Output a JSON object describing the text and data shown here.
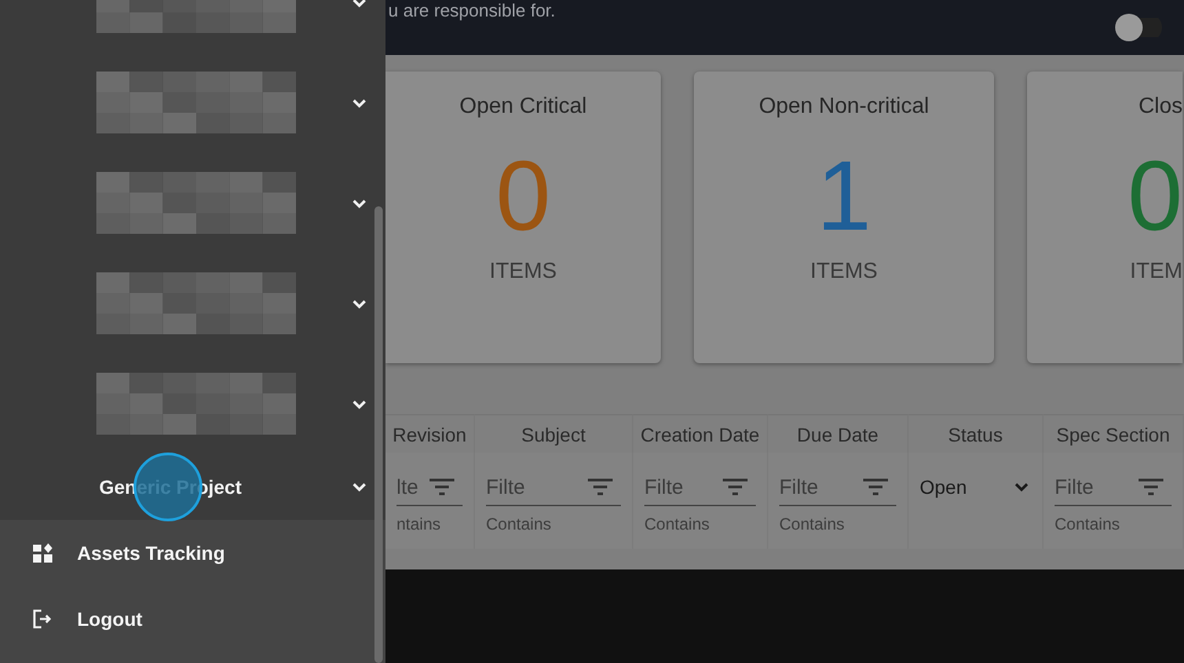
{
  "header": {
    "text": "u are responsible for.",
    "toggle": {
      "on": false
    }
  },
  "drawer": {
    "items": [
      {
        "kind": "redacted",
        "expanded": false
      },
      {
        "kind": "redacted",
        "expanded": false
      },
      {
        "kind": "redacted",
        "expanded": false
      },
      {
        "kind": "redacted",
        "expanded": false
      },
      {
        "kind": "redacted",
        "expanded": false
      },
      {
        "kind": "project",
        "label": "Generic Project",
        "expanded": false
      }
    ],
    "links": [
      {
        "label": "Assets Tracking"
      },
      {
        "label": "Logout"
      }
    ]
  },
  "cards": [
    {
      "title": "Open Critical",
      "value": "0",
      "unit": "ITEMS",
      "color": "#9c5512"
    },
    {
      "title": "Open Non-critical",
      "value": "1",
      "unit": "ITEMS",
      "color": "#1f5f98"
    },
    {
      "title": "Clos",
      "value": "0",
      "unit": "ITEM",
      "color": "#1d6e34"
    }
  ],
  "table": {
    "columns": [
      {
        "label": "Revision",
        "filter": {
          "kind": "text",
          "placeholder": "lte",
          "hint": "ntains"
        }
      },
      {
        "label": "Subject",
        "filter": {
          "kind": "text",
          "placeholder": "Filte",
          "hint": "Contains"
        }
      },
      {
        "label": "Creation Date",
        "filter": {
          "kind": "text",
          "placeholder": "Filte",
          "hint": "Contains"
        }
      },
      {
        "label": "Due Date",
        "filter": {
          "kind": "text",
          "placeholder": "Filte",
          "hint": "Contains"
        }
      },
      {
        "label": "Status",
        "filter": {
          "kind": "select",
          "value": "Open"
        }
      },
      {
        "label": "Spec Section",
        "filter": {
          "kind": "text",
          "placeholder": "Filte",
          "hint": "Contains"
        }
      }
    ]
  }
}
